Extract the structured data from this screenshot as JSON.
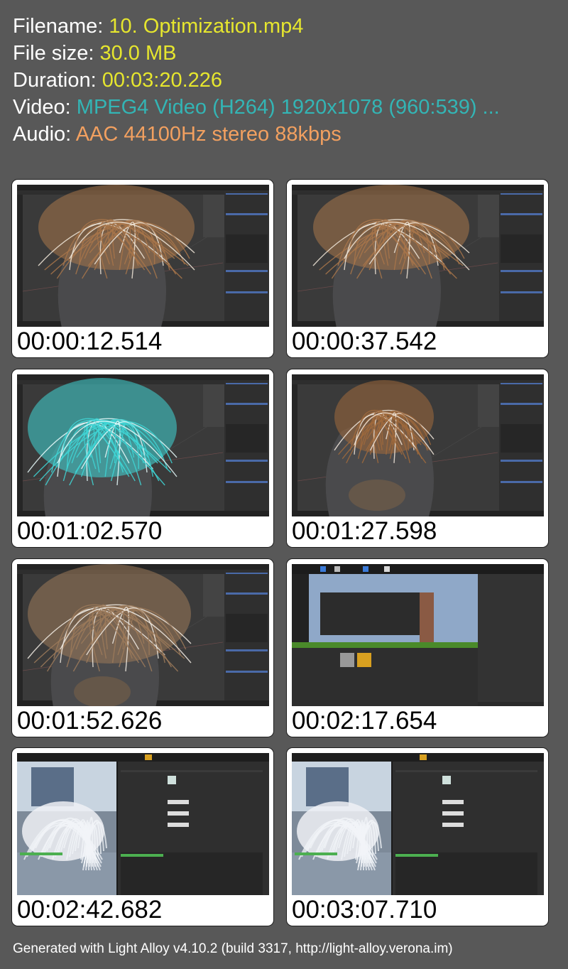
{
  "info": {
    "filename_label": "Filename:",
    "filename": "10. Optimization.mp4",
    "filesize_label": "File size:",
    "filesize": "30.0 MB",
    "duration_label": "Duration:",
    "duration": "00:03:20.226",
    "video_label": "Video:",
    "video": "MPEG4 Video (H264) 1920x1078 (960:539) ...",
    "audio_label": "Audio:",
    "audio": "AAC 44100Hz stereo 88kbps"
  },
  "colors": {
    "background": "#585858",
    "label": "#ffffff",
    "filename_value": "#e6e62e",
    "video_value": "#33b5b5",
    "audio_value": "#f2a060"
  },
  "thumbnails": [
    {
      "timestamp": "00:00:12.514",
      "scene": "blender-hair-brown"
    },
    {
      "timestamp": "00:00:37.542",
      "scene": "blender-hair-brown"
    },
    {
      "timestamp": "00:01:02.570",
      "scene": "blender-hair-cyan"
    },
    {
      "timestamp": "00:01:27.598",
      "scene": "blender-hair-brown-small"
    },
    {
      "timestamp": "00:01:52.626",
      "scene": "blender-hair-brown-side"
    },
    {
      "timestamp": "00:02:17.654",
      "scene": "unreal-editor-import"
    },
    {
      "timestamp": "00:02:42.682",
      "scene": "unreal-material-white-hair"
    },
    {
      "timestamp": "00:03:07.710",
      "scene": "unreal-material-white-hair"
    }
  ],
  "footer": "Generated with Light Alloy v4.10.2 (build 3317, http://light-alloy.verona.im)"
}
